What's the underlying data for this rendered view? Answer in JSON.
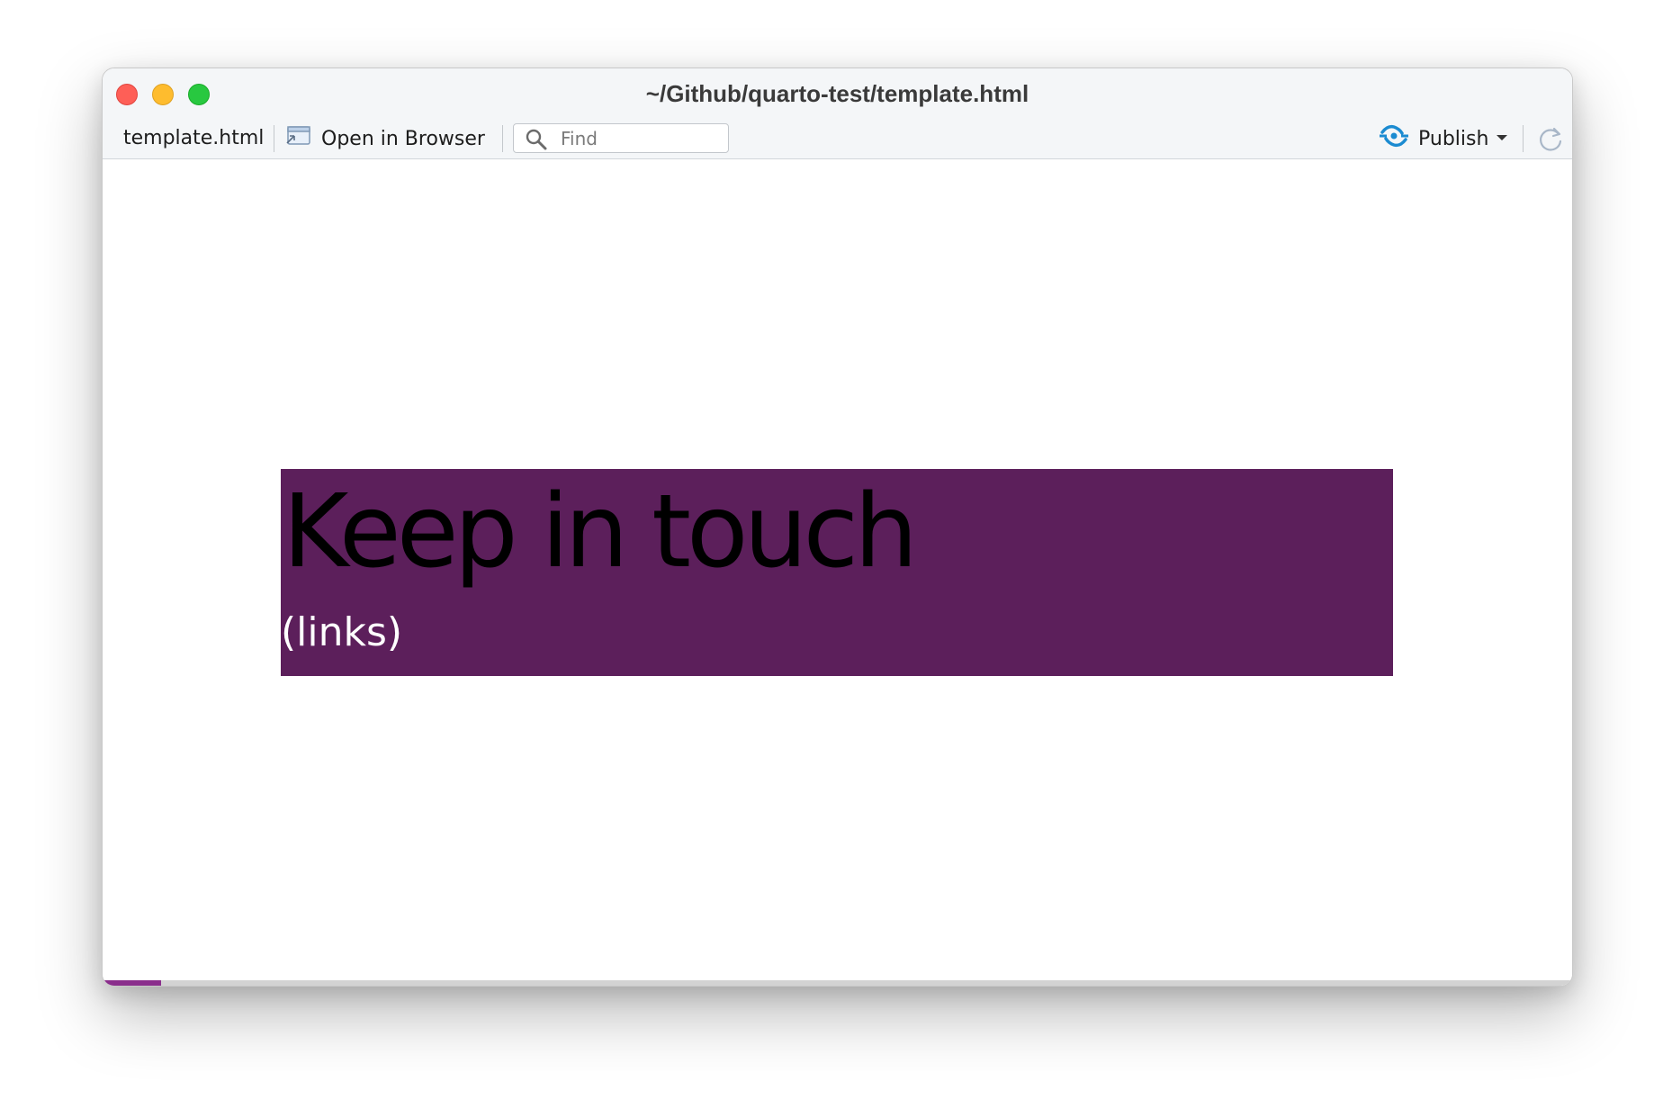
{
  "window": {
    "title": "~/Github/quarto-test/template.html"
  },
  "toolbar": {
    "filename": "template.html",
    "open_in_browser_label": "Open in Browser",
    "find_placeholder": "Find",
    "find_value": "",
    "publish_label": "Publish"
  },
  "slide": {
    "title": "Keep in touch",
    "subtitle": "(links)",
    "background_color": "#5c1f5b",
    "title_color": "#000000",
    "subtitle_color": "#ffffff"
  },
  "presentation": {
    "progress_fraction": 0.04,
    "accent_color": "#8a2e8c"
  },
  "icons": {
    "open_in_browser": "browser-window-icon",
    "find": "search-icon",
    "publish": "publish-connect-icon",
    "publish_menu": "caret-down-icon",
    "refresh": "refresh-icon",
    "menu": "hamburger-menu-icon"
  }
}
